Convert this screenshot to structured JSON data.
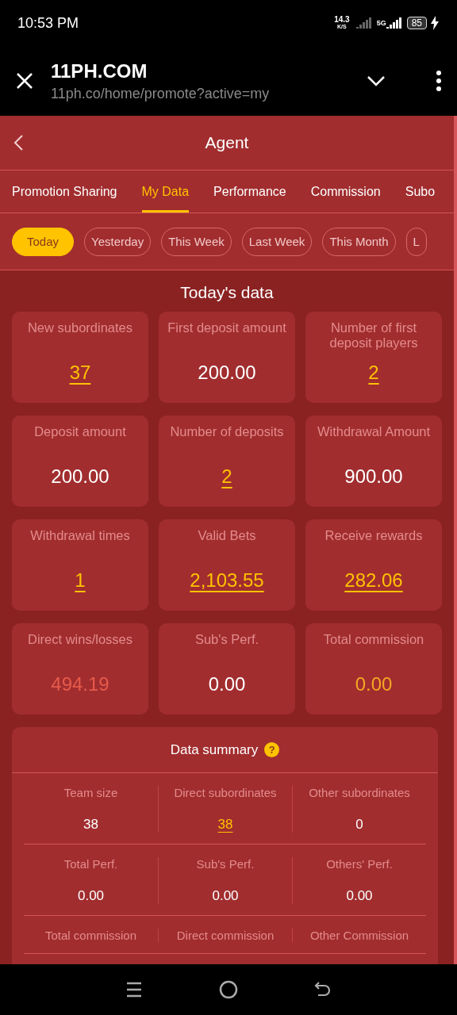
{
  "status_bar": {
    "time": "10:53 PM",
    "speed": "14.3",
    "speed_unit": "K/S",
    "network": "5G",
    "battery": "85"
  },
  "browser": {
    "title": "11PH.COM",
    "url": "11ph.co/home/promote?active=my"
  },
  "header": {
    "title": "Agent"
  },
  "tabs": [
    {
      "label": "Promotion Sharing",
      "selected": false
    },
    {
      "label": "My Data",
      "selected": true
    },
    {
      "label": "Performance",
      "selected": false
    },
    {
      "label": "Commission",
      "selected": false
    },
    {
      "label": "Subo",
      "selected": false
    }
  ],
  "filters": [
    {
      "label": "Today",
      "selected": true
    },
    {
      "label": "Yesterday",
      "selected": false
    },
    {
      "label": "This Week",
      "selected": false
    },
    {
      "label": "Last Week",
      "selected": false
    },
    {
      "label": "This Month",
      "selected": false
    },
    {
      "label": "L",
      "selected": false
    }
  ],
  "section_title": "Today's data",
  "stats": [
    {
      "label": "New subordinates",
      "value": "37",
      "kind": "link"
    },
    {
      "label": "First deposit amount",
      "value": "200.00",
      "kind": "plain"
    },
    {
      "label": "Number of first deposit players",
      "value": "2",
      "kind": "link"
    },
    {
      "label": "Deposit amount",
      "value": "200.00",
      "kind": "plain"
    },
    {
      "label": "Number of deposits",
      "value": "2",
      "kind": "link"
    },
    {
      "label": "Withdrawal Amount",
      "value": "900.00",
      "kind": "plain"
    },
    {
      "label": "Withdrawal times",
      "value": "1",
      "kind": "link"
    },
    {
      "label": "Valid Bets",
      "value": "2,103.55",
      "kind": "link"
    },
    {
      "label": "Receive rewards",
      "value": "282.06",
      "kind": "link"
    },
    {
      "label": "Direct wins/losses",
      "value": "494.19",
      "kind": "loss"
    },
    {
      "label": "Sub's Perf.",
      "value": "0.00",
      "kind": "plain"
    },
    {
      "label": "Total commission",
      "value": "0.00",
      "kind": "gold"
    }
  ],
  "summary": {
    "title": "Data summary",
    "help": "?",
    "rows": [
      [
        {
          "label": "Team size",
          "value": "38",
          "kind": "plain"
        },
        {
          "label": "Direct subordinates",
          "value": "38",
          "kind": "link"
        },
        {
          "label": "Other subordinates",
          "value": "0",
          "kind": "plain"
        }
      ],
      [
        {
          "label": "Total Perf.",
          "value": "0.00",
          "kind": "plain"
        },
        {
          "label": "Sub's Perf.",
          "value": "0.00",
          "kind": "plain"
        },
        {
          "label": "Others' Perf.",
          "value": "0.00",
          "kind": "plain"
        }
      ],
      [
        {
          "label": "Total commission"
        },
        {
          "label": "Direct commission"
        },
        {
          "label": "Other Commission"
        }
      ]
    ]
  }
}
